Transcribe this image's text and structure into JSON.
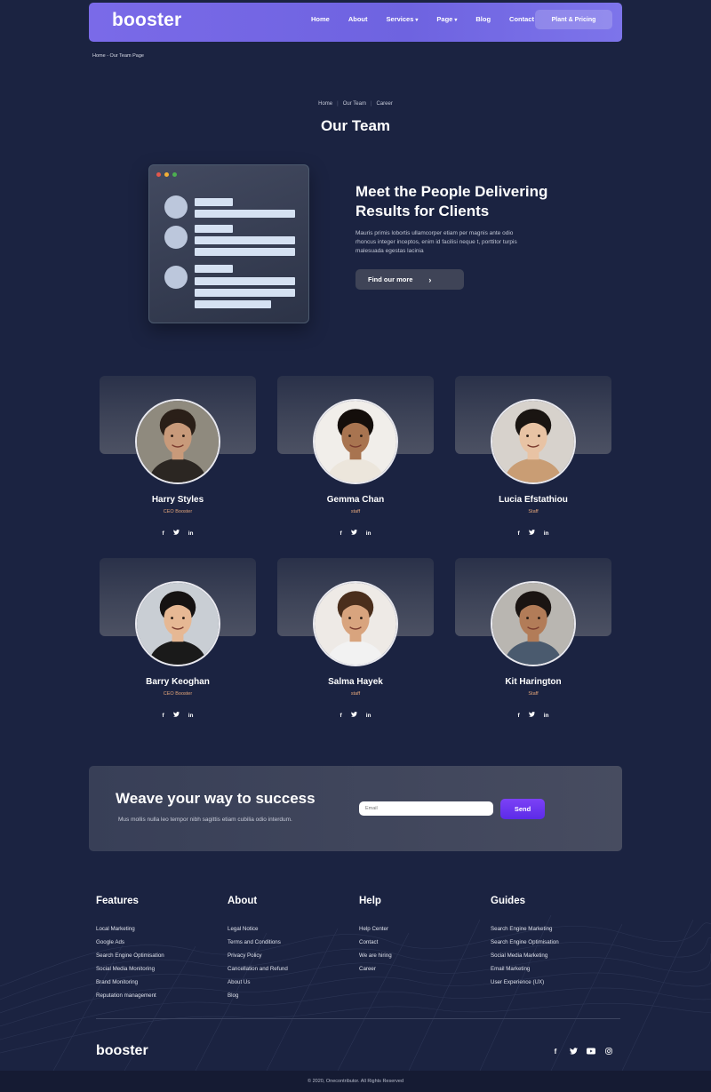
{
  "nav": {
    "logo": "booster",
    "links": [
      {
        "label": "Home",
        "has_dropdown": false
      },
      {
        "label": "About",
        "has_dropdown": false
      },
      {
        "label": "Services",
        "has_dropdown": true
      },
      {
        "label": "Page",
        "has_dropdown": true
      },
      {
        "label": "Blog",
        "has_dropdown": false
      },
      {
        "label": "Contact",
        "has_dropdown": false
      }
    ],
    "cta": "Plant & Pricing"
  },
  "page_crumb": "Home - Our Team Page",
  "hero": {
    "crumbs": [
      "Home",
      "Our Team",
      "Career"
    ],
    "title": "Our Team",
    "heading_line1": "Meet the People Delivering",
    "heading_line2": "Results for Clients",
    "text": "Mauris primis lobortis ullamcorper etiam per magnis ante odio rhoncus integer inceptos, enim id facilisi neque t, porttitor turpis malesuada egestas lacinia",
    "button": "Find our more"
  },
  "team": [
    {
      "name": "Harry Styles",
      "role": "CEO Booster"
    },
    {
      "name": "Gemma Chan",
      "role": "staff"
    },
    {
      "name": "Lucia Efstathiou",
      "role": "Staff"
    },
    {
      "name": "Barry Keoghan",
      "role": "CEO Booster"
    },
    {
      "name": "Salma Hayek",
      "role": "staff"
    },
    {
      "name": "Kit Harington",
      "role": "Staff"
    }
  ],
  "social_icons": [
    "facebook-icon",
    "twitter-icon",
    "linkedin-icon"
  ],
  "newsletter": {
    "title": "Weave your way to success",
    "text": "Mus mollis nulla leo tempor nibh sagittis etiam cubilia odio interdum.",
    "placeholder": "Email",
    "button": "Send"
  },
  "footer": {
    "columns": [
      {
        "title": "Features",
        "links": [
          "Local Marketing",
          "Google Ads",
          "Search Engine Optimisation",
          "Social Media Monitoring",
          "Brand Monitoring",
          "Reputation management"
        ]
      },
      {
        "title": "About",
        "links": [
          "Legal Notice",
          "Terms and Conditions",
          "Privacy Policy",
          "Cancellation and Refund",
          "About Us",
          "Blog"
        ]
      },
      {
        "title": "Help",
        "links": [
          "Help Center",
          "Contact",
          "We are hiring",
          "Career"
        ]
      },
      {
        "title": "Guides",
        "links": [
          "Search Engine Marketing",
          "Search Engine Optimisation",
          "Social Media Marketing",
          "Email Marketing",
          "User Experience (UX)"
        ]
      }
    ],
    "logo": "booster",
    "socials": [
      "facebook-icon",
      "twitter-icon",
      "youtube-icon",
      "instagram-icon"
    ],
    "copyright": "© 2020, Onecontributor. All Rights Reserved"
  },
  "colors": {
    "background": "#1b2341",
    "nav_gradient_start": "#7a6ae8",
    "accent_purple": "#6a35f0",
    "role_text": "#e3a57a"
  }
}
